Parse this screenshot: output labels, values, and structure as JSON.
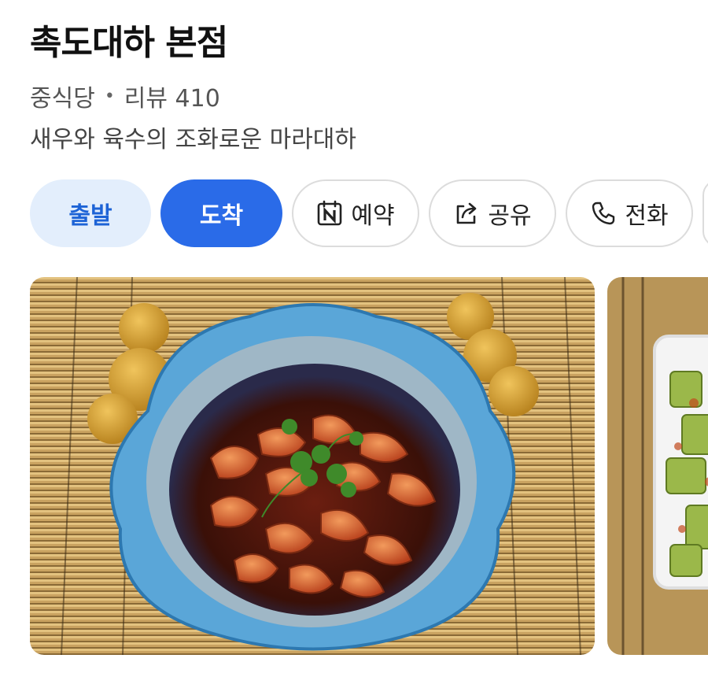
{
  "place": {
    "name": "촉도대하 본점",
    "category": "중식당",
    "separator": "•",
    "reviews": "리뷰 410",
    "description": "새우와 육수의 조화로운 마라대하"
  },
  "actions": {
    "depart": "출발",
    "arrive": "도착",
    "reserve": "예약",
    "share": "공유",
    "call": "전화"
  },
  "colors": {
    "accent": "#2a6be8",
    "accent_light": "#e3eefc",
    "accent_text": "#1d63d6"
  },
  "icons": {
    "reserve": "naver-calendar-icon",
    "share": "share-icon",
    "call": "phone-icon"
  }
}
